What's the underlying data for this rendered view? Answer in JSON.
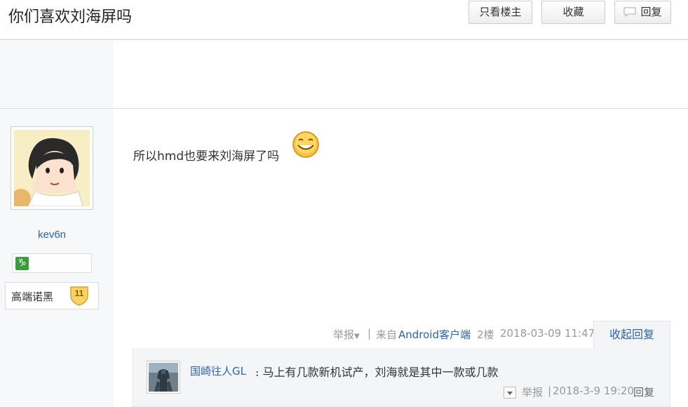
{
  "thread": {
    "title": "你们喜欢刘海屏吗"
  },
  "toolbar": {
    "only_op_label": "只看楼主",
    "favorite_label": "收藏",
    "reply_label": "回复"
  },
  "author": {
    "username": "kev6n",
    "zodiac_icon": "capricorn-icon",
    "level_name": "高端诺黑",
    "level_number": "11"
  },
  "post": {
    "content": "所以hmd也要来刘海屏了吗",
    "emoji": "smile-emoji",
    "report_label": "举报",
    "separator": "|",
    "from_label": "来自",
    "client_label": "Android客户端",
    "floor": "2楼",
    "date": "2018-03-09 11:47",
    "collapse_label": "收起回复"
  },
  "replies": [
    {
      "username": "国崎往人GL",
      "text": ": 马上有几款新机试产，刘海就是其中一款或几款",
      "report_label": "举报",
      "separator": "|",
      "date": "2018-3-9 19:20",
      "reply_label": "回复"
    }
  ],
  "colors": {
    "link": "#2d64b3",
    "meta": "#999999",
    "sidebar_bg": "#f7f8fa",
    "reply_bg": "#f3f5f7"
  }
}
